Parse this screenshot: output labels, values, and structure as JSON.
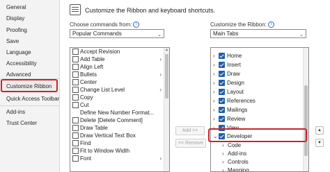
{
  "sidebar": {
    "items": [
      {
        "label": "General"
      },
      {
        "label": "Display"
      },
      {
        "label": "Proofing"
      },
      {
        "label": "Save"
      },
      {
        "label": "Language"
      },
      {
        "label": "Accessibility"
      },
      {
        "label": "Advanced"
      },
      {
        "label": "Customize Ribbon"
      },
      {
        "label": "Quick Access Toolbar"
      },
      {
        "label": "Add-ins"
      },
      {
        "label": "Trust Center"
      }
    ],
    "selected": "Customize Ribbon"
  },
  "header": {
    "title": "Customize the Ribbon and keyboard shortcuts."
  },
  "left_panel": {
    "label": "Choose commands from:",
    "select_value": "Popular Commands",
    "commands": [
      {
        "label": "Accept Revision",
        "icon": "accept-revision-icon"
      },
      {
        "label": "Add Table",
        "icon": "table-icon",
        "submenu": true
      },
      {
        "label": "Align Left",
        "icon": "align-left-icon"
      },
      {
        "label": "Bullets",
        "icon": "bullets-icon",
        "submenu": true
      },
      {
        "label": "Center",
        "icon": "center-align-icon"
      },
      {
        "label": "Change List Level",
        "icon": "list-level-icon",
        "submenu": true
      },
      {
        "label": "Copy",
        "icon": "copy-icon"
      },
      {
        "label": "Cut",
        "icon": "cut-icon"
      },
      {
        "label": "Define New Number Format...",
        "icon": ""
      },
      {
        "label": "Delete [Delete Comment]",
        "icon": "delete-comment-icon"
      },
      {
        "label": "Draw Table",
        "icon": "draw-table-icon"
      },
      {
        "label": "Draw Vertical Text Box",
        "icon": "text-box-icon"
      },
      {
        "label": "Find",
        "icon": "find-icon"
      },
      {
        "label": "Fit to Window Width",
        "icon": "fit-width-icon"
      },
      {
        "label": "Font",
        "icon": "font-icon",
        "submenu": true
      }
    ]
  },
  "buttons": {
    "add": "Add >>",
    "remove": "<< Remove"
  },
  "right_panel": {
    "label": "Customize the Ribbon:",
    "select_value": "Main Tabs",
    "tabs": [
      {
        "label": "Home",
        "checked": true,
        "expanded": false
      },
      {
        "label": "Insert",
        "checked": true,
        "expanded": false
      },
      {
        "label": "Draw",
        "checked": true,
        "expanded": false
      },
      {
        "label": "Design",
        "checked": true,
        "expanded": false
      },
      {
        "label": "Layout",
        "checked": true,
        "expanded": false
      },
      {
        "label": "References",
        "checked": true,
        "expanded": false
      },
      {
        "label": "Mailings",
        "checked": true,
        "expanded": false
      },
      {
        "label": "Review",
        "checked": true,
        "expanded": false
      },
      {
        "label": "View",
        "checked": true,
        "expanded": false
      },
      {
        "label": "Developer",
        "checked": true,
        "expanded": true,
        "highlighted": true
      }
    ],
    "developer_groups": [
      {
        "label": "Code"
      },
      {
        "label": "Add-ins"
      },
      {
        "label": "Controls"
      },
      {
        "label": "Mapping"
      }
    ]
  },
  "colors": {
    "accent": "#1f5fad",
    "highlight": "#c8242b"
  }
}
